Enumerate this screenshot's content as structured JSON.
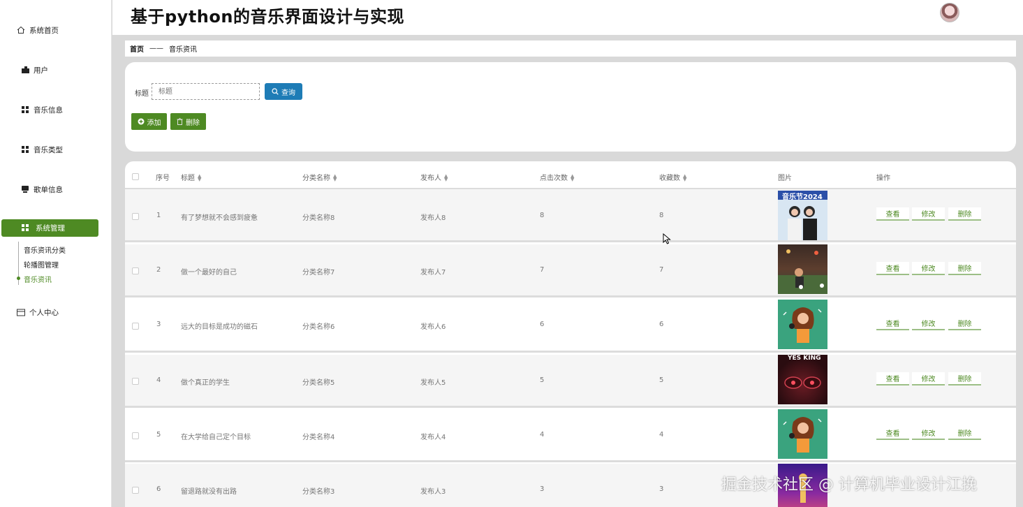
{
  "header": {
    "title": "基于python的音乐界面设计与实现"
  },
  "sidebar": {
    "items": [
      {
        "label": "系统首页",
        "icon": "home-icon"
      },
      {
        "label": "用户",
        "icon": "user-icon"
      },
      {
        "label": "音乐信息",
        "icon": "grid-icon"
      },
      {
        "label": "音乐类型",
        "icon": "grid-icon"
      },
      {
        "label": "歌单信息",
        "icon": "playlist-icon"
      },
      {
        "label": "系统管理",
        "icon": "grid-icon",
        "active": true
      },
      {
        "label": "个人中心",
        "icon": "id-card-icon"
      }
    ],
    "submenu": [
      {
        "label": "音乐资讯分类"
      },
      {
        "label": "轮播图管理"
      },
      {
        "label": "音乐资讯",
        "active": true
      }
    ]
  },
  "breadcrumb": {
    "home": "首页",
    "separator": "——",
    "current": "音乐资讯"
  },
  "search": {
    "label": "标题",
    "placeholder": "标题",
    "query_label": "查询",
    "add_label": "添加",
    "delete_label": "删除"
  },
  "table": {
    "columns": [
      "序号",
      "标题",
      "分类名称",
      "发布人",
      "点击次数",
      "收藏数",
      "图片",
      "操作"
    ],
    "actions": {
      "view": "查看",
      "edit": "修改",
      "delete": "删除"
    },
    "rows": [
      {
        "index": "1",
        "title": "有了梦想就不会感到疲惫",
        "category": "分类名称8",
        "publisher": "发布人8",
        "clicks": "8",
        "favorites": "8",
        "image": "music-festival-2024-cover",
        "image_text": "音乐节2024"
      },
      {
        "index": "2",
        "title": "做一个最好的自己",
        "category": "分类名称7",
        "publisher": "发布人7",
        "clicks": "7",
        "favorites": "7",
        "image": "concert-stage-photo",
        "image_text": ""
      },
      {
        "index": "3",
        "title": "远大的目标是成功的磁石",
        "category": "分类名称6",
        "publisher": "发布人6",
        "clicks": "6",
        "favorites": "6",
        "image": "singer-illustration",
        "image_text": ""
      },
      {
        "index": "4",
        "title": "做个真正的学生",
        "category": "分类名称5",
        "publisher": "发布人5",
        "clicks": "5",
        "favorites": "5",
        "image": "yes-king-speaker-cover",
        "image_text": "YES KING"
      },
      {
        "index": "5",
        "title": "在大学给自己定个目标",
        "category": "分类名称4",
        "publisher": "发布人4",
        "clicks": "4",
        "favorites": "4",
        "image": "singer-illustration",
        "image_text": ""
      },
      {
        "index": "6",
        "title": "留退路就没有出路",
        "category": "分类名称3",
        "publisher": "发布人3",
        "clicks": "3",
        "favorites": "3",
        "image": "purple-music-cover",
        "image_text": ""
      }
    ]
  },
  "watermark": "掘金技术社区 @ 计算机毕业设计江挽",
  "colors": {
    "accent": "#4e8a23",
    "query_button": "#1e7cb6"
  }
}
